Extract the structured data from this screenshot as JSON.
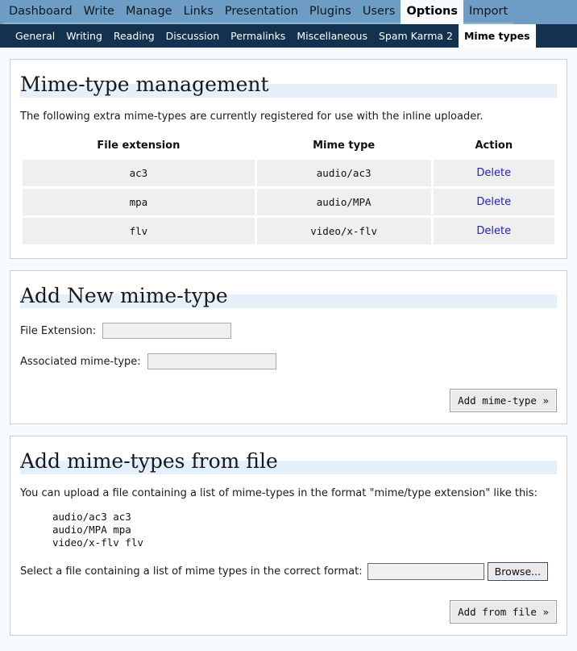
{
  "topnav": {
    "items": [
      {
        "label": "Dashboard",
        "active": false
      },
      {
        "label": "Write",
        "active": false
      },
      {
        "label": "Manage",
        "active": false
      },
      {
        "label": "Links",
        "active": false
      },
      {
        "label": "Presentation",
        "active": false
      },
      {
        "label": "Plugins",
        "active": false
      },
      {
        "label": "Users",
        "active": false
      },
      {
        "label": "Options",
        "active": true
      },
      {
        "label": "Import",
        "active": false
      }
    ],
    "bg_color": "#6d9dc5",
    "active_bg": "#f7fbfd"
  },
  "subnav": {
    "items": [
      {
        "label": "General",
        "active": false
      },
      {
        "label": "Writing",
        "active": false
      },
      {
        "label": "Reading",
        "active": false
      },
      {
        "label": "Discussion",
        "active": false
      },
      {
        "label": "Permalinks",
        "active": false
      },
      {
        "label": "Miscellaneous",
        "active": false
      },
      {
        "label": "Spam Karma 2",
        "active": false
      },
      {
        "label": "Mime types",
        "active": true
      }
    ],
    "bg_color": "#13324f",
    "active_bg": "#ffffff"
  },
  "management": {
    "heading": "Mime-type management",
    "intro": "The following extra mime-types are currently registered for use with the inline uploader.",
    "columns": [
      "File extension",
      "Mime type",
      "Action"
    ],
    "rows": [
      {
        "extension": "ac3",
        "mime": "audio/ac3",
        "action": "Delete"
      },
      {
        "extension": "mpa",
        "mime": "audio/MPA",
        "action": "Delete"
      },
      {
        "extension": "flv",
        "mime": "video/x-flv",
        "action": "Delete"
      }
    ],
    "link_color": "#2222bb"
  },
  "add_new": {
    "heading": "Add New mime-type",
    "extension_label": "File Extension:",
    "extension_value": "",
    "extension_placeholder": "",
    "mime_label": "Associated mime-type:",
    "mime_value": "",
    "mime_placeholder": "",
    "submit_label": "Add mime-type »"
  },
  "add_from_file": {
    "heading": "Add mime-types from file",
    "intro": "You can upload a file containing a list of mime-types in the format \"mime/type extension\" like this:",
    "example": "audio/ac3 ac3\naudio/MPA mpa\nvideo/x-flv flv",
    "file_label": "Select a file containing a list of mime types in the correct format:",
    "file_value": "",
    "browse_label": "Browse...",
    "submit_label": "Add from file »"
  }
}
